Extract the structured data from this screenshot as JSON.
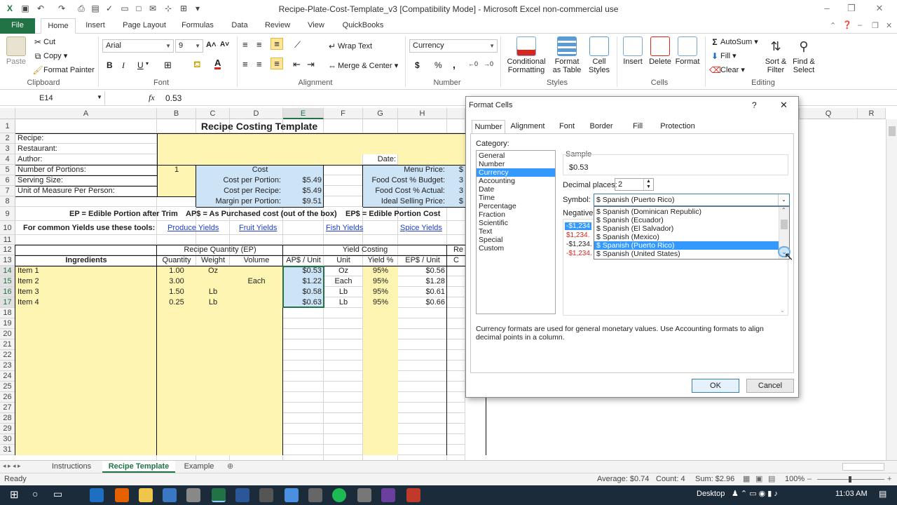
{
  "window": {
    "title": "Recipe-Plate-Cost-Template_v3  [Compatibility Mode]  -  Microsoft Excel non-commercial use"
  },
  "ribbon_tabs": [
    "File",
    "Home",
    "Insert",
    "Page Layout",
    "Formulas",
    "Data",
    "Review",
    "View",
    "QuickBooks"
  ],
  "clipboard": {
    "paste": "Paste",
    "cut": "Cut",
    "copy": "Copy",
    "format_painter": "Format Painter",
    "label": "Clipboard"
  },
  "font": {
    "name": "Arial",
    "size": "9",
    "bold": "B",
    "italic": "I",
    "underline": "U",
    "label": "Font"
  },
  "alignment": {
    "wrap": "Wrap Text",
    "merge": "Merge & Center",
    "label": "Alignment"
  },
  "number": {
    "format": "Currency",
    "dollar": "$",
    "percent": "%",
    "comma": ",",
    "label": "Number"
  },
  "styles": {
    "conditional": "Conditional Formatting",
    "table": "Format as Table",
    "cell": "Cell Styles",
    "label": "Styles"
  },
  "cells": {
    "insert": "Insert",
    "delete": "Delete",
    "format": "Format",
    "label": "Cells"
  },
  "editing": {
    "autosum": "AutoSum",
    "fill": "Fill",
    "clear": "Clear",
    "sort": "Sort & Filter",
    "find": "Find & Select",
    "label": "Editing"
  },
  "formula_bar": {
    "name_box": "E14",
    "fx": "fx",
    "value": "0.53"
  },
  "columns": [
    "A",
    "B",
    "C",
    "D",
    "E",
    "F",
    "G",
    "H",
    "Q",
    "R"
  ],
  "rows": [
    "1",
    "2",
    "3",
    "4",
    "5",
    "6",
    "7",
    "8",
    "9",
    "10",
    "11",
    "12",
    "13",
    "14",
    "15",
    "16",
    "17",
    "18",
    "19",
    "20",
    "21",
    "22",
    "23",
    "24",
    "25",
    "26",
    "27",
    "28",
    "29",
    "30",
    "31"
  ],
  "sheet": {
    "title": "Recipe Costing Template",
    "recipe": "Recipe:",
    "restaurant": "Restaurant:",
    "author": "Author:",
    "date": "Date:",
    "portions_label": "Number of Portions:",
    "portions_value": "1",
    "serving": "Serving Size:",
    "uom": "Unit of Measure Per Person:",
    "cost_header": "Cost",
    "cost_rows": [
      {
        "label": "Cost per Portion:",
        "value": "$5.49"
      },
      {
        "label": "Cost per Recipe:",
        "value": "$5.49"
      },
      {
        "label": "Margin per Portion:",
        "value": "$9.51"
      }
    ],
    "right_rows": [
      {
        "label": "Menu Price:",
        "value": "$"
      },
      {
        "label": "Food Cost % Budget:",
        "value": "3"
      },
      {
        "label": "Food Cost % Actual:",
        "value": "3"
      },
      {
        "label": "Ideal Selling Price:",
        "value": "$"
      }
    ],
    "legend_ep": "EP = Edible Portion after Trim",
    "legend_ap": "AP$ = As Purchased cost (out of the box)",
    "legend_eps": "EP$ = Edible Portion Cost",
    "tools_label": "For common Yields use these tools:",
    "links": [
      "Produce Yields",
      "Fruit Yields",
      "Fish Yields",
      "Spice Yields"
    ],
    "group_qty": "Recipe Quantity (EP)",
    "group_yield": "Yield Costing",
    "group_re": "Re",
    "headers": [
      "Ingredients",
      "Quantity",
      "Weight",
      "Volume",
      "AP$ / Unit",
      "Unit",
      "Yield %",
      "EP$ / Unit",
      "C"
    ],
    "items": [
      {
        "name": "Item 1",
        "qty": "1.00",
        "weight": "Oz",
        "volume": "",
        "ap": "$0.53",
        "unit": "Oz",
        "yield": "95%",
        "ep": "$0.56"
      },
      {
        "name": "Item 2",
        "qty": "3.00",
        "weight": "",
        "volume": "Each",
        "ap": "$1.22",
        "unit": "Each",
        "yield": "95%",
        "ep": "$1.28"
      },
      {
        "name": "Item 3",
        "qty": "1.50",
        "weight": "Lb",
        "volume": "",
        "ap": "$0.58",
        "unit": "Lb",
        "yield": "95%",
        "ep": "$0.61"
      },
      {
        "name": "Item 4",
        "qty": "0.25",
        "weight": "Lb",
        "volume": "",
        "ap": "$0.63",
        "unit": "Lb",
        "yield": "95%",
        "ep": "$0.66"
      }
    ]
  },
  "sheet_tabs": [
    "Instructions",
    "Recipe Template",
    "Example"
  ],
  "status": {
    "ready": "Ready",
    "average": "Average: $0.74",
    "count": "Count: 4",
    "sum": "Sum: $2.96",
    "zoom": "100%"
  },
  "taskbar": {
    "desktop": "Desktop",
    "time": "11:03 AM"
  },
  "dialog": {
    "title": "Format Cells",
    "help": "?",
    "close": "✕",
    "tabs": [
      "Number",
      "Alignment",
      "Font",
      "Border",
      "Fill",
      "Protection"
    ],
    "category_label": "Category:",
    "categories": [
      "General",
      "Number",
      "Currency",
      "Accounting",
      "Date",
      "Time",
      "Percentage",
      "Fraction",
      "Scientific",
      "Text",
      "Special",
      "Custom"
    ],
    "selected_category": "Currency",
    "sample_label": "Sample",
    "sample_value": "$0.53",
    "decimal_label": "Decimal places:",
    "decimal_value": "2",
    "symbol_label": "Symbol:",
    "symbol_value": "$ Spanish (Puerto Rico)",
    "symbol_options": [
      "$ Spanish (Dominican Republic)",
      "$ Spanish (Ecuador)",
      "$ Spanish (El Salvador)",
      "$ Spanish (Mexico)",
      "$ Spanish (Puerto Rico)",
      "$ Spanish (United States)"
    ],
    "negative_label": "Negative",
    "negatives": [
      "-$1,234",
      "$1,234.",
      "-$1,234.",
      "-$1,234."
    ],
    "description": "Currency formats are used for general monetary values.  Use Accounting formats to align decimal points in a column.",
    "ok": "OK",
    "cancel": "Cancel"
  },
  "colors": {
    "excel_green": "#217346",
    "cell_yellow": "#fff5b3",
    "cell_blue": "#cde4f7",
    "selection_blue": "#3399ff",
    "link": "#1f3fc7",
    "negative_red": "#d9261c"
  }
}
